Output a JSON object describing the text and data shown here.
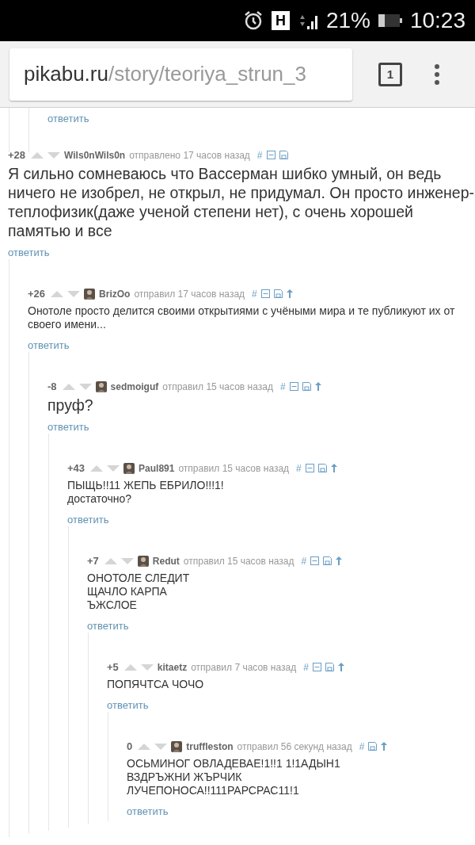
{
  "status_bar": {
    "network": "H",
    "battery": "21%",
    "time": "10:23"
  },
  "browser": {
    "url_host": "pikabu.ru",
    "url_path": "/story/teoriya_strun_3",
    "tab_count": "1"
  },
  "thread_tail": {
    "reply": "ответить"
  },
  "comments": [
    {
      "score": "+28",
      "author": "Wils0nWils0n",
      "avatar": false,
      "verb": "отправлено",
      "time": "17 часов назад",
      "kind": "large",
      "lines": [
        "Я сильно сомневаюсь что Вассерман шибко умный, он ведь ничего не изобрел, не открыл, не придумал. Он просто инженер-теплофизик(даже ученой степени нет), с очень хорошей памятью и все"
      ],
      "actions": [
        {
          "kind": "anchor",
          "text": "#"
        },
        {
          "kind": "collapse"
        },
        {
          "kind": "save"
        }
      ],
      "reply": "ответить",
      "children": [
        {
          "score": "+26",
          "author": "BrizOo",
          "avatar": true,
          "verb": "отправил",
          "time": "17 часов назад",
          "kind": "normal",
          "lines": [
            "Онотоле просто делится своими открытиями с учёными мира и те публикуют их от своего имени..."
          ],
          "actions": [
            {
              "kind": "anchor",
              "text": "#"
            },
            {
              "kind": "collapse"
            },
            {
              "kind": "save"
            },
            {
              "kind": "parent"
            }
          ],
          "reply": "ответить",
          "children": [
            {
              "score": "-8",
              "author": "sedmoiguf",
              "avatar": true,
              "verb": "отправил",
              "time": "15 часов назад",
              "kind": "large",
              "lines": [
                "пруф?"
              ],
              "actions": [
                {
                  "kind": "anchor",
                  "text": "#"
                },
                {
                  "kind": "collapse"
                },
                {
                  "kind": "save"
                },
                {
                  "kind": "parent"
                }
              ],
              "reply": "ответить",
              "children": [
                {
                  "score": "+43",
                  "author": "Paul891",
                  "avatar": true,
                  "verb": "отправил",
                  "time": "15 часов назад",
                  "kind": "normal",
                  "lines": [
                    "ПЫЩЬ!!11 ЖЕПЬ ЕБРИЛО!!!1!",
                    "достаточно?"
                  ],
                  "actions": [
                    {
                      "kind": "anchor",
                      "text": "#"
                    },
                    {
                      "kind": "collapse"
                    },
                    {
                      "kind": "save"
                    },
                    {
                      "kind": "parent"
                    }
                  ],
                  "reply": "ответить",
                  "children": [
                    {
                      "score": "+7",
                      "author": "Redut",
                      "avatar": true,
                      "verb": "отправил",
                      "time": "15 часов назад",
                      "kind": "normal",
                      "lines": [
                        "ОНОТОЛЕ СЛЕДИТ",
                        "ЩАЧЛО КАРПА",
                        "ЪЖСЛОЕ"
                      ],
                      "actions": [
                        {
                          "kind": "anchor",
                          "text": "#"
                        },
                        {
                          "kind": "collapse"
                        },
                        {
                          "kind": "save"
                        },
                        {
                          "kind": "parent"
                        }
                      ],
                      "reply": "ответить",
                      "children": [
                        {
                          "score": "+5",
                          "author": "kitaetz",
                          "avatar": false,
                          "verb": "отправил",
                          "time": "7 часов назад",
                          "kind": "normal",
                          "lines": [
                            "ПОПЯЧТСА ЧОЧО"
                          ],
                          "actions": [
                            {
                              "kind": "anchor",
                              "text": "#"
                            },
                            {
                              "kind": "collapse"
                            },
                            {
                              "kind": "save"
                            },
                            {
                              "kind": "parent"
                            }
                          ],
                          "reply": "ответить",
                          "children": [
                            {
                              "score": "0",
                              "author": "truffleston",
                              "avatar": true,
                              "verb": "отправил",
                              "time": "56 секунд назад",
                              "kind": "normal",
                              "lines": [
                                "ОСЬМИНОГ ОВЛАДЕВАЕ!1!!1 1!1АДЫН1",
                                "ВЗДРЪЖНИ ЖЪРЧИК",
                                "ЛУЧЕПОНОСА!!111РАРСРАС11!1"
                              ],
                              "actions": [
                                {
                                  "kind": "anchor",
                                  "text": "#"
                                },
                                {
                                  "kind": "save"
                                },
                                {
                                  "kind": "parent"
                                }
                              ],
                              "reply": "ответить"
                            }
                          ]
                        }
                      ]
                    }
                  ]
                }
              ]
            }
          ]
        }
      ]
    }
  ]
}
